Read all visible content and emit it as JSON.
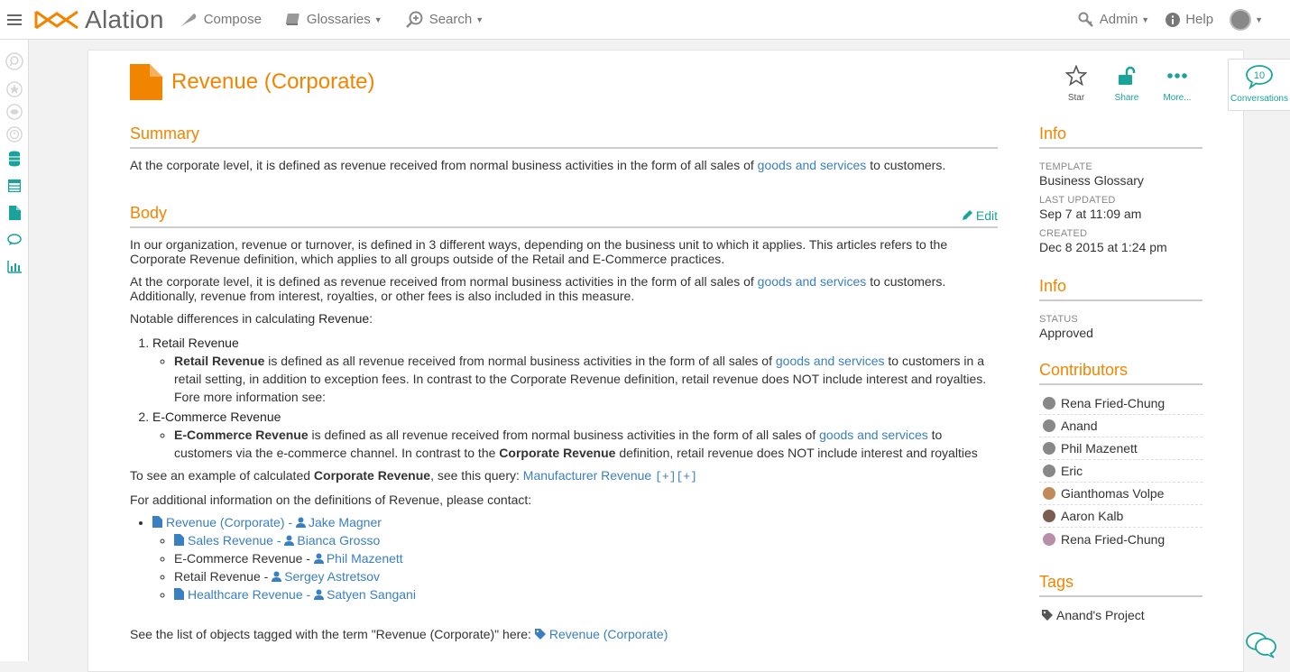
{
  "nav": {
    "logo": "Alation",
    "compose": "Compose",
    "glossaries": "Glossaries",
    "search": "Search",
    "admin": "Admin",
    "help": "Help"
  },
  "page": {
    "title": "Revenue (Corporate)",
    "actions": {
      "star": "Star",
      "share": "Share",
      "more": "More..."
    }
  },
  "summary": {
    "heading": "Summary",
    "pre": "At the corporate level, it is defined as revenue received from normal business activities in the form of all sales of ",
    "link": "goods and services",
    "post": " to customers."
  },
  "body": {
    "heading": "Body",
    "edit": "Edit",
    "p1": "In our organization, revenue or turnover, is defined in 3 different ways, depending on the business unit to which it applies. This articles refers to the Corporate Revenue definition, which applies to all groups outside of the Retail and E-Commerce practices.",
    "p2_pre": "At the corporate level, it is defined as revenue received from normal business activities in the form of all sales of ",
    "p2_link": "goods and services",
    "p2_post": " to customers. Additionally, revenue from interest, royalties, or other fees is also included in this measure.",
    "p3_pre": "Notable differences in calculating ",
    "p3_bold": "Revenue",
    "p3_post": ":",
    "li1_title": "Retail Revenue",
    "li1_bold": "Retail Revenue",
    "li1_pre": " is defined as all revenue received from normal business activities in the form of all sales of ",
    "li1_link": "goods and services",
    "li1_post": " to customers in a retail setting, in addition to exception fees. In contrast to the Corporate Revenue definition, retail revenue does NOT include interest and royalties. Fore more information see:",
    "li2_title": "E-Commerce Revenue",
    "li2_bold": "E-Commerce Revenue",
    "li2_pre": " is defined as all revenue received from normal business activities in the form of all sales of ",
    "li2_link": "goods and services",
    "li2_mid": " to customers via the e-commerce channel. In contrast to the ",
    "li2_bold2": "Corporate Revenue",
    "li2_post": " definition, retail revenue does NOT include interest and royalties",
    "p4_pre": "To see an example of calculated ",
    "p4_bold": "Corporate Revenue",
    "p4_mid": ", see this query: ",
    "p4_link": "Manufacturer Revenue",
    "p4_mono": "[+][+]",
    "p5": "For additional information on the definitions of Revenue, please contact:",
    "contacts": {
      "c0_doc": "Revenue (Corporate)",
      "c0_user": "Jake Magner",
      "c1_doc": "Sales Revenue",
      "c1_user": "Bianca Grosso",
      "c2_text": "E-Commerce Revenue",
      "c2_user": "Phil Mazenett",
      "c3_text": "Retail Revenue",
      "c3_user": "Sergey Astretsov",
      "c4_doc": "Healthcare Revenue",
      "c4_user": "Satyen Sangani",
      "sep": " - "
    },
    "p6_pre": "See the list of objects tagged with the term \"Revenue (Corporate)\" here: ",
    "p6_link": "Revenue (Corporate)"
  },
  "sidebar": {
    "info1": {
      "heading": "Info",
      "template_label": "TEMPLATE",
      "template_value": "Business Glossary",
      "updated_label": "LAST UPDATED",
      "updated_value": "Sep 7 at 11:09 am",
      "created_label": "CREATED",
      "created_value": "Dec 8 2015 at 1:24 pm"
    },
    "info2": {
      "heading": "Info",
      "status_label": "STATUS",
      "status_value": "Approved"
    },
    "contributors": {
      "heading": "Contributors",
      "names": [
        "Rena Fried-Chung",
        "Anand",
        "Phil Mazenett",
        "Eric",
        "Gianthomas Volpe",
        "Aaron Kalb",
        "Rena Fried-Chung"
      ]
    },
    "tags": {
      "heading": "Tags",
      "items": [
        "Anand's Project"
      ]
    }
  },
  "conversations": {
    "count": "10",
    "label": "Conversations"
  },
  "colors": {
    "accent": "#f28500",
    "link": "#3a7fc1",
    "teal": "#1aa39a"
  }
}
